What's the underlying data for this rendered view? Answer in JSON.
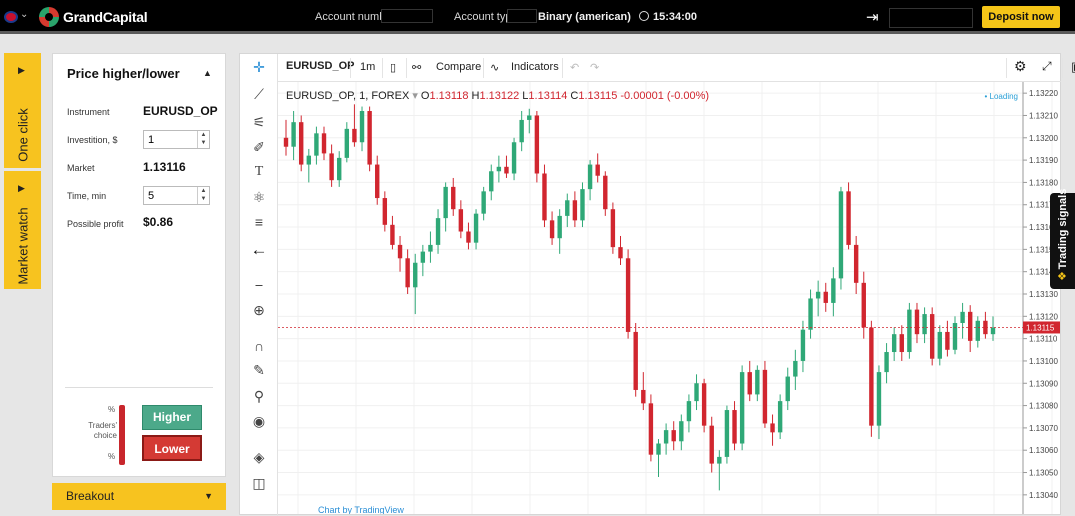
{
  "colors": {
    "yellow": "#f7c31f",
    "up": "#2fa877",
    "down": "#d1262f",
    "higher": "#4ca98a",
    "lower": "#d43a34"
  },
  "topbar": {
    "brand": "GrandCapital",
    "account_number_label": "Account number",
    "account_type_label": "Account type",
    "account_type_value": "Binary  (american)",
    "time": "15:34:00",
    "deposit_label": "Deposit now"
  },
  "sidetabs": {
    "one_click": "One click",
    "market_watch": "Market watch"
  },
  "panel": {
    "title": "Price higher/lower",
    "instrument_label": "Instrument",
    "instrument_value": "EURUSD_OP",
    "investition_label": "Investition, $",
    "investition_value": "1",
    "market_label": "Market",
    "market_value": "1.13116",
    "time_label": "Time, min",
    "time_value": "5",
    "profit_label": "Possible profit",
    "profit_value": "$0.86",
    "pct_top": "%",
    "pct_bottom": "%",
    "traders_choice": "Traders' choice",
    "higher_label": "Higher",
    "lower_label": "Lower",
    "breakout_label": "Breakout"
  },
  "chart_toolbar": {
    "symbol": "EURUSD_OP",
    "interval": "1m",
    "compare": "Compare",
    "indicators": "Indicators"
  },
  "legend": {
    "title": "EURUSD_OP, 1, FOREX",
    "o_label": "O",
    "o": "1.13118",
    "h_label": "H",
    "h": "1.13122",
    "l_label": "L",
    "l": "1.13114",
    "c_label": "C",
    "c": "1.13115",
    "change": "-0.00001 (-0.00%)",
    "loading": "Loading"
  },
  "trading_signals": "Trading signals",
  "footer_link": "Chart by TradingView",
  "chart_data": {
    "type": "candlestick",
    "ylim": [
      1.13035,
      1.13225
    ],
    "y_ticks": [
      "1.13220",
      "1.13210",
      "1.13200",
      "1.13190",
      "1.13180",
      "1.13170",
      "1.13160",
      "1.13150",
      "1.13140",
      "1.13130",
      "1.13120",
      "1.13110",
      "1.13100",
      "1.13090",
      "1.13080",
      "1.13070",
      "1.13060",
      "1.13050",
      "1.13040"
    ],
    "last_price": "1.13115",
    "candles": [
      [
        1.132,
        1.13208,
        1.13192,
        1.13196
      ],
      [
        1.13196,
        1.13212,
        1.1319,
        1.13207
      ],
      [
        1.13207,
        1.1321,
        1.13185,
        1.13188
      ],
      [
        1.13188,
        1.13195,
        1.1318,
        1.13192
      ],
      [
        1.13192,
        1.13205,
        1.13188,
        1.13202
      ],
      [
        1.13202,
        1.13205,
        1.1319,
        1.13193
      ],
      [
        1.13193,
        1.13197,
        1.13178,
        1.13181
      ],
      [
        1.13181,
        1.13194,
        1.13178,
        1.13191
      ],
      [
        1.13191,
        1.13207,
        1.13189,
        1.13204
      ],
      [
        1.13204,
        1.13215,
        1.13196,
        1.13198
      ],
      [
        1.13198,
        1.13214,
        1.13194,
        1.13212
      ],
      [
        1.13212,
        1.13214,
        1.13185,
        1.13188
      ],
      [
        1.13188,
        1.13192,
        1.1317,
        1.13173
      ],
      [
        1.13173,
        1.13176,
        1.13158,
        1.13161
      ],
      [
        1.13161,
        1.13165,
        1.1315,
        1.13152
      ],
      [
        1.13152,
        1.13156,
        1.1314,
        1.13146
      ],
      [
        1.13146,
        1.1315,
        1.1313,
        1.13133
      ],
      [
        1.13133,
        1.13148,
        1.13121,
        1.13144
      ],
      [
        1.13144,
        1.13152,
        1.13138,
        1.13149
      ],
      [
        1.13149,
        1.13158,
        1.13144,
        1.13152
      ],
      [
        1.13152,
        1.13168,
        1.13148,
        1.13164
      ],
      [
        1.13164,
        1.1318,
        1.13158,
        1.13178
      ],
      [
        1.13178,
        1.13182,
        1.13165,
        1.13168
      ],
      [
        1.13168,
        1.13172,
        1.13155,
        1.13158
      ],
      [
        1.13158,
        1.13162,
        1.1315,
        1.13153
      ],
      [
        1.13153,
        1.13168,
        1.1315,
        1.13166
      ],
      [
        1.13166,
        1.13178,
        1.13163,
        1.13176
      ],
      [
        1.13176,
        1.13188,
        1.13172,
        1.13185
      ],
      [
        1.13185,
        1.13192,
        1.1318,
        1.13187
      ],
      [
        1.13187,
        1.13192,
        1.13182,
        1.13184
      ],
      [
        1.13184,
        1.132,
        1.13181,
        1.13198
      ],
      [
        1.13198,
        1.13212,
        1.13194,
        1.13208
      ],
      [
        1.13208,
        1.13213,
        1.13202,
        1.1321
      ],
      [
        1.1321,
        1.13212,
        1.1318,
        1.13184
      ],
      [
        1.13184,
        1.13188,
        1.1316,
        1.13163
      ],
      [
        1.13163,
        1.13167,
        1.13152,
        1.13155
      ],
      [
        1.13155,
        1.13168,
        1.13148,
        1.13165
      ],
      [
        1.13165,
        1.13175,
        1.1316,
        1.13172
      ],
      [
        1.13172,
        1.13176,
        1.1316,
        1.13163
      ],
      [
        1.13163,
        1.1318,
        1.1316,
        1.13177
      ],
      [
        1.13177,
        1.1319,
        1.13172,
        1.13188
      ],
      [
        1.13188,
        1.13193,
        1.1318,
        1.13183
      ],
      [
        1.13183,
        1.13185,
        1.13165,
        1.13168
      ],
      [
        1.13168,
        1.13171,
        1.13148,
        1.13151
      ],
      [
        1.13151,
        1.13156,
        1.13143,
        1.13146
      ],
      [
        1.13146,
        1.1315,
        1.1311,
        1.13113
      ],
      [
        1.13113,
        1.13117,
        1.13084,
        1.13087
      ],
      [
        1.13087,
        1.13095,
        1.13078,
        1.13081
      ],
      [
        1.13081,
        1.13085,
        1.13055,
        1.13058
      ],
      [
        1.13058,
        1.13065,
        1.13048,
        1.13063
      ],
      [
        1.13063,
        1.13072,
        1.13058,
        1.13069
      ],
      [
        1.13069,
        1.13073,
        1.1306,
        1.13064
      ],
      [
        1.13064,
        1.13076,
        1.1306,
        1.13073
      ],
      [
        1.13073,
        1.13085,
        1.13068,
        1.13082
      ],
      [
        1.13082,
        1.13094,
        1.13078,
        1.1309
      ],
      [
        1.1309,
        1.13092,
        1.13068,
        1.13071
      ],
      [
        1.13071,
        1.13075,
        1.1305,
        1.13054
      ],
      [
        1.13054,
        1.1306,
        1.13042,
        1.13057
      ],
      [
        1.13057,
        1.1308,
        1.13054,
        1.13078
      ],
      [
        1.13078,
        1.13082,
        1.1306,
        1.13063
      ],
      [
        1.13063,
        1.13098,
        1.1306,
        1.13095
      ],
      [
        1.13095,
        1.131,
        1.13082,
        1.13085
      ],
      [
        1.13085,
        1.13098,
        1.13082,
        1.13096
      ],
      [
        1.13096,
        1.131,
        1.1307,
        1.13072
      ],
      [
        1.13072,
        1.13076,
        1.13062,
        1.13068
      ],
      [
        1.13068,
        1.13085,
        1.13065,
        1.13082
      ],
      [
        1.13082,
        1.13097,
        1.13078,
        1.13093
      ],
      [
        1.13093,
        1.13105,
        1.13087,
        1.131
      ],
      [
        1.131,
        1.13118,
        1.13095,
        1.13114
      ],
      [
        1.13114,
        1.13132,
        1.1311,
        1.13128
      ],
      [
        1.13128,
        1.13136,
        1.1312,
        1.13131
      ],
      [
        1.13131,
        1.13135,
        1.13122,
        1.13126
      ],
      [
        1.13126,
        1.13142,
        1.1312,
        1.13137
      ],
      [
        1.13137,
        1.13178,
        1.13132,
        1.13176
      ],
      [
        1.13176,
        1.1318,
        1.1315,
        1.13152
      ],
      [
        1.13152,
        1.13156,
        1.1313,
        1.13135
      ],
      [
        1.13135,
        1.1314,
        1.1311,
        1.13115
      ],
      [
        1.13115,
        1.13118,
        1.13066,
        1.13071
      ],
      [
        1.13071,
        1.13098,
        1.13065,
        1.13095
      ],
      [
        1.13095,
        1.13108,
        1.1309,
        1.13104
      ],
      [
        1.13104,
        1.13115,
        1.131,
        1.13112
      ],
      [
        1.13112,
        1.13116,
        1.131,
        1.13104
      ],
      [
        1.13104,
        1.13126,
        1.13101,
        1.13123
      ],
      [
        1.13123,
        1.13126,
        1.13108,
        1.13112
      ],
      [
        1.13112,
        1.13124,
        1.13108,
        1.13121
      ],
      [
        1.13121,
        1.13124,
        1.13098,
        1.13101
      ],
      [
        1.13101,
        1.13116,
        1.13098,
        1.13113
      ],
      [
        1.13113,
        1.13118,
        1.13102,
        1.13105
      ],
      [
        1.13105,
        1.1312,
        1.13103,
        1.13117
      ],
      [
        1.13117,
        1.13126,
        1.1311,
        1.13122
      ],
      [
        1.13122,
        1.13125,
        1.13104,
        1.13109
      ],
      [
        1.13109,
        1.1312,
        1.13106,
        1.13118
      ],
      [
        1.13118,
        1.13122,
        1.1311,
        1.13112
      ],
      [
        1.13112,
        1.1312,
        1.13109,
        1.13115
      ]
    ]
  }
}
